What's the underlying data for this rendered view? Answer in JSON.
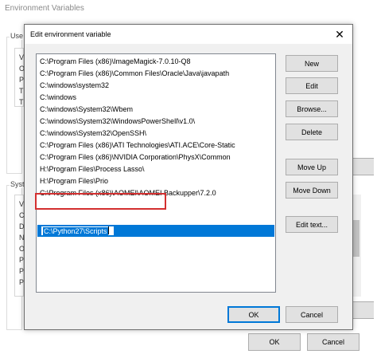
{
  "background_window": {
    "title": "Environment Variables",
    "user_group_label": "Use",
    "system_group_label": "Syst",
    "user_list_letters": [
      "V",
      "O",
      "P",
      "T",
      "T"
    ],
    "system_list_letters": [
      "V",
      "C",
      "D",
      "N",
      "O",
      "P",
      "P",
      "P",
      "P"
    ],
    "ok_label": "OK",
    "cancel_label": "Cancel"
  },
  "dialog": {
    "title": "Edit environment variable",
    "close_glyph": "✕",
    "paths": [
      "C:\\Program Files (x86)\\ImageMagick-7.0.10-Q8",
      "C:\\Program Files (x86)\\Common Files\\Oracle\\Java\\javapath",
      "C:\\windows\\system32",
      "C:\\windows",
      "C:\\windows\\System32\\Wbem",
      "C:\\windows\\System32\\WindowsPowerShell\\v1.0\\",
      "C:\\windows\\System32\\OpenSSH\\",
      "C:\\Program Files (x86)\\ATI Technologies\\ATI.ACE\\Core-Static",
      "C:\\Program Files (x86)\\NVIDIA Corporation\\PhysX\\Common",
      "H:\\Program Files\\Process Lasso\\",
      "H:\\Program Files\\Prio",
      "C:\\Program Files (x86)\\AOMEI\\AOMEI Backupper\\7.2.0"
    ],
    "editing_value": "C:\\Python27\\Scripts",
    "buttons": {
      "new": "New",
      "edit": "Edit",
      "browse": "Browse...",
      "delete": "Delete",
      "move_up": "Move Up",
      "move_down": "Move Down",
      "edit_text": "Edit text...",
      "ok": "OK",
      "cancel": "Cancel"
    }
  },
  "colors": {
    "selection": "#0078d7",
    "highlight": "#d32f2f",
    "button_face": "#e1e1e1",
    "dialog_face": "#f0f0f0"
  }
}
